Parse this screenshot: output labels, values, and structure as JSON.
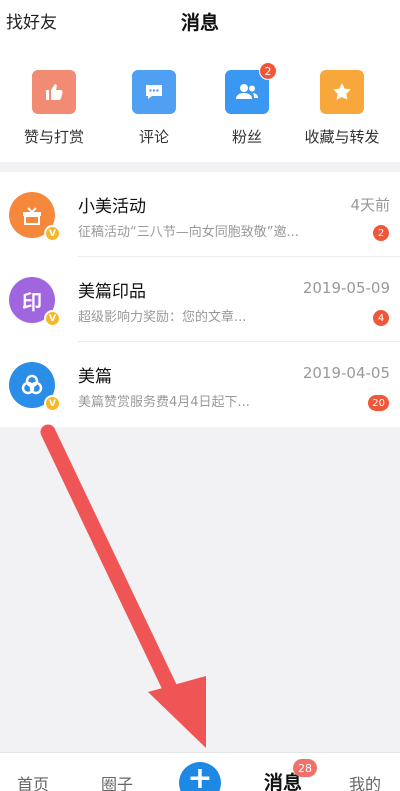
{
  "header": {
    "left_label": "找好友",
    "title": "消息"
  },
  "quick_actions": [
    {
      "label": "赞与打赏",
      "icon": "thumbs-up-icon",
      "color": "#f28b74"
    },
    {
      "label": "评论",
      "icon": "comment-icon",
      "color": "#4f9ff2"
    },
    {
      "label": "粉丝",
      "icon": "fans-icon",
      "color": "#3b98f2",
      "badge": "2"
    },
    {
      "label": "收藏与转发",
      "icon": "star-icon",
      "color": "#f8a83a"
    }
  ],
  "messages": [
    {
      "name": "小美活动",
      "time": "4天前",
      "preview": "征稿活动“三八节—向女同胞致敬”邀...",
      "count": "2",
      "avatar_color": "#f5883b",
      "avatar_icon": "gift-icon"
    },
    {
      "name": "美篇印品",
      "time": "2019-05-09",
      "preview": "超级影响力奖励：您的文章...",
      "count": "4",
      "avatar_color": "#a066e0",
      "avatar_text": "印"
    },
    {
      "name": "美篇",
      "time": "2019-04-05",
      "preview": "美篇赞赏服务费4月4日起下...",
      "count": "20",
      "avatar_color": "#2a8de8",
      "avatar_icon": "meipian-logo-icon"
    }
  ],
  "verified_mark": "V",
  "tabbar": {
    "home": "首页",
    "circle": "圈子",
    "plus": "+",
    "messages": "消息",
    "messages_badge": "28",
    "mine": "我的"
  },
  "colors": {
    "accent_blue": "#1e88e5",
    "badge_red": "#f0573a",
    "arrow_red": "#f05555"
  }
}
